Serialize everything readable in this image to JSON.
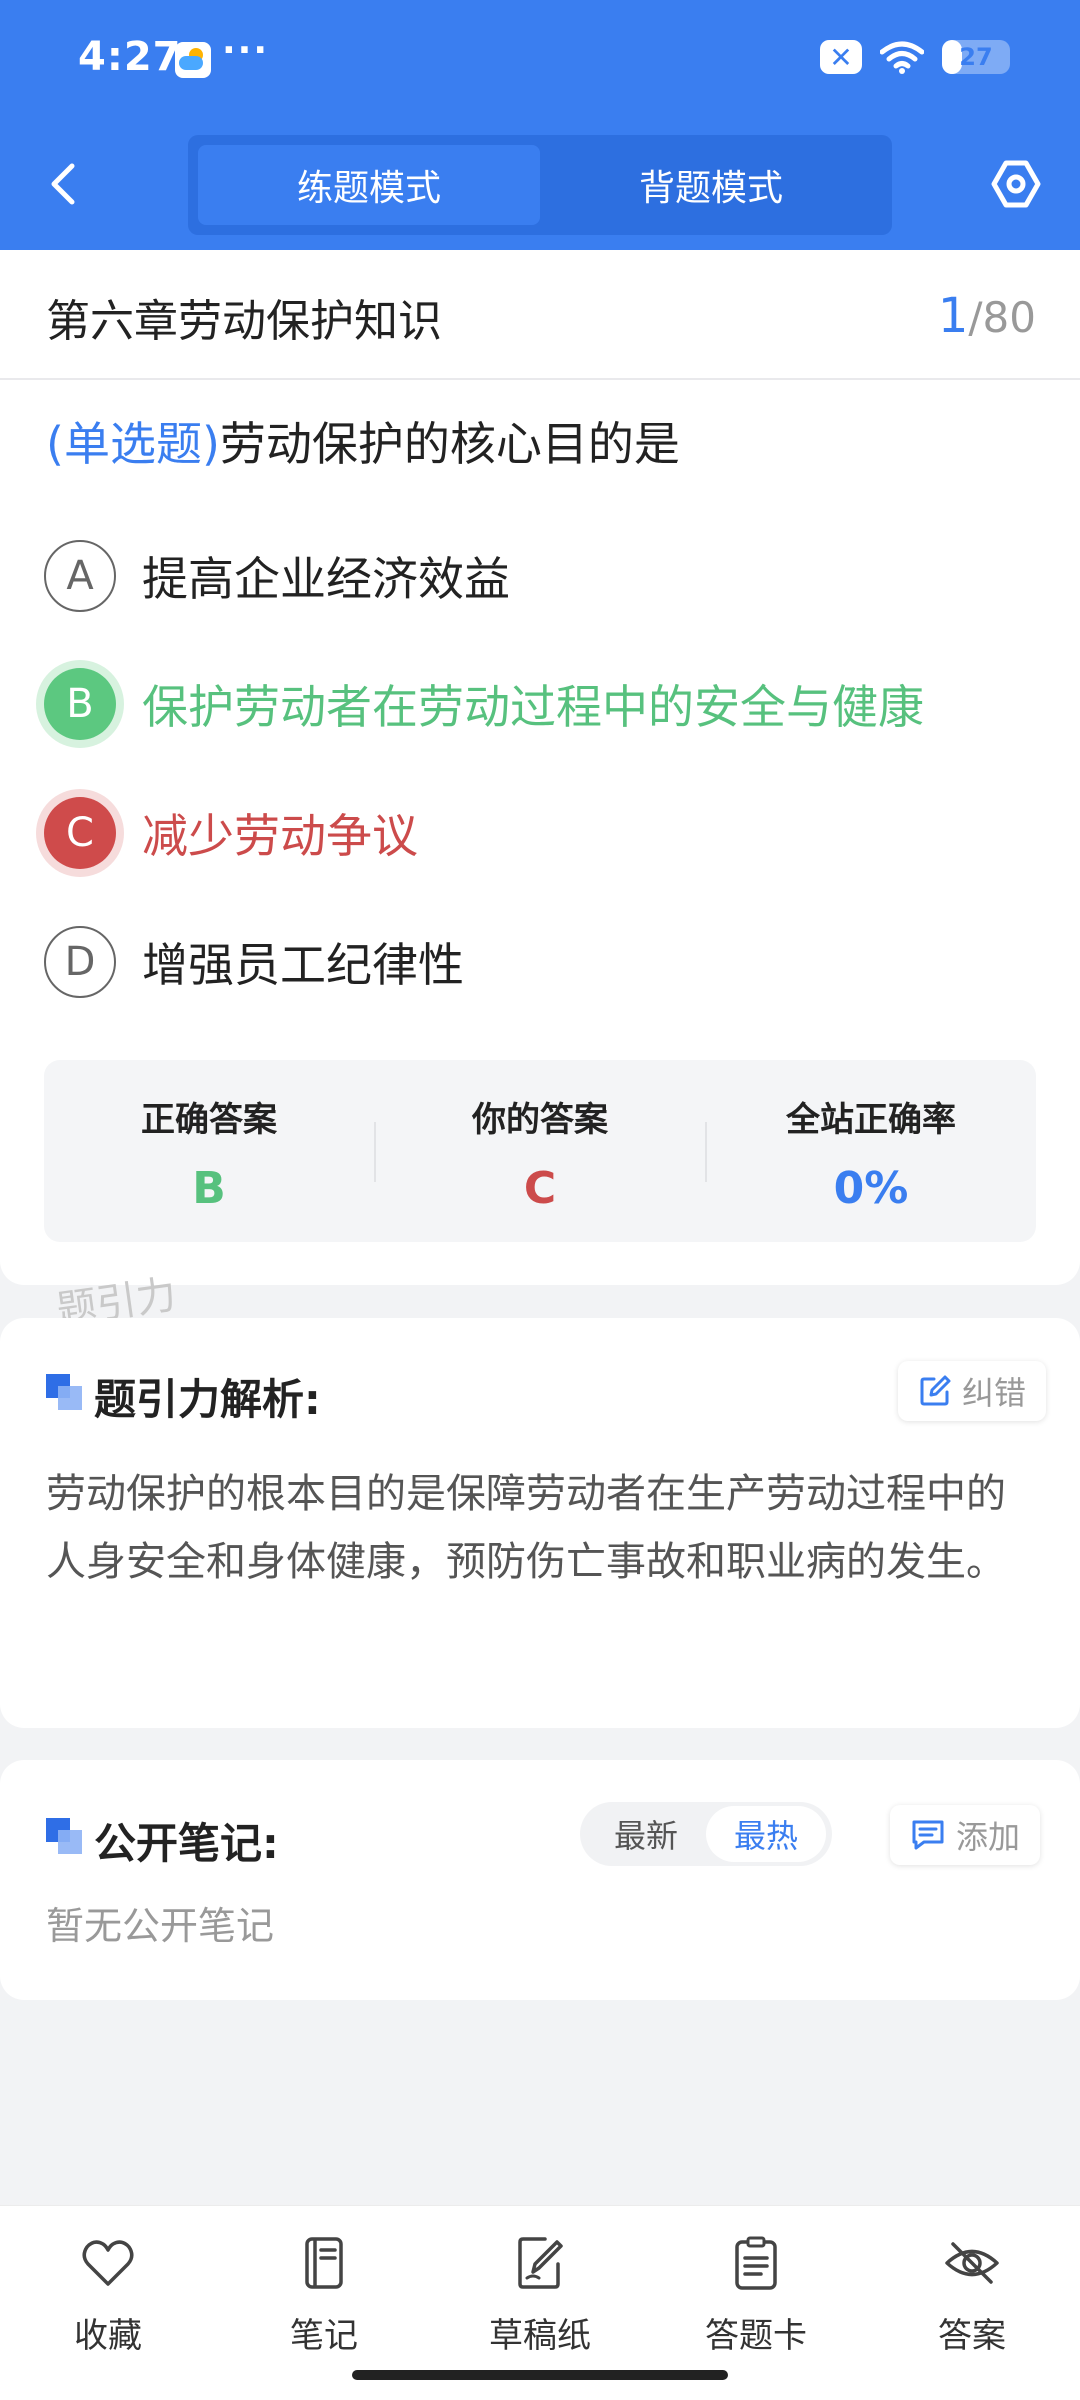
{
  "status_bar": {
    "time": "4:27",
    "more": "···",
    "battery": "27"
  },
  "header": {
    "tabs": [
      {
        "label": "练题模式",
        "active": true
      },
      {
        "label": "背题模式",
        "active": false
      }
    ]
  },
  "question": {
    "chapter": "第六章劳动保护知识",
    "current": "1",
    "total": "/80",
    "type": "(单选题)",
    "text": "劳动保护的核心目的是",
    "options": [
      {
        "letter": "A",
        "text": "提高企业经济效益",
        "state": "normal"
      },
      {
        "letter": "B",
        "text": "保护劳动者在劳动过程中的安全与健康",
        "state": "correct"
      },
      {
        "letter": "C",
        "text": "减少劳动争议",
        "state": "wrong"
      },
      {
        "letter": "D",
        "text": "增强员工纪律性",
        "state": "normal"
      }
    ]
  },
  "stats": {
    "correct_label": "正确答案",
    "correct_value": "B",
    "yours_label": "你的答案",
    "yours_value": "C",
    "rate_label": "全站正确率",
    "rate_value": "0%"
  },
  "watermark": "题引力",
  "analysis": {
    "title": "题引力解析:",
    "report_label": "纠错",
    "text": "劳动保护的根本目的是保障劳动者在生产劳动过程中的人身安全和身体健康，预防伤亡事故和职业病的发生。"
  },
  "notes": {
    "title": "公开笔记:",
    "sort_options": [
      "最新",
      "最热"
    ],
    "sort_active": "最热",
    "add_label": "添加",
    "empty_text": "暂无公开笔记"
  },
  "bottom_nav": [
    {
      "label": "收藏",
      "icon": "heart-icon"
    },
    {
      "label": "笔记",
      "icon": "notebook-icon"
    },
    {
      "label": "草稿纸",
      "icon": "draft-icon"
    },
    {
      "label": "答题卡",
      "icon": "answer-card-icon"
    },
    {
      "label": "答案",
      "icon": "eye-off-icon"
    }
  ],
  "colors": {
    "primary": "#3a7ef0",
    "correct": "#57c17e",
    "wrong": "#cc4b4b"
  }
}
